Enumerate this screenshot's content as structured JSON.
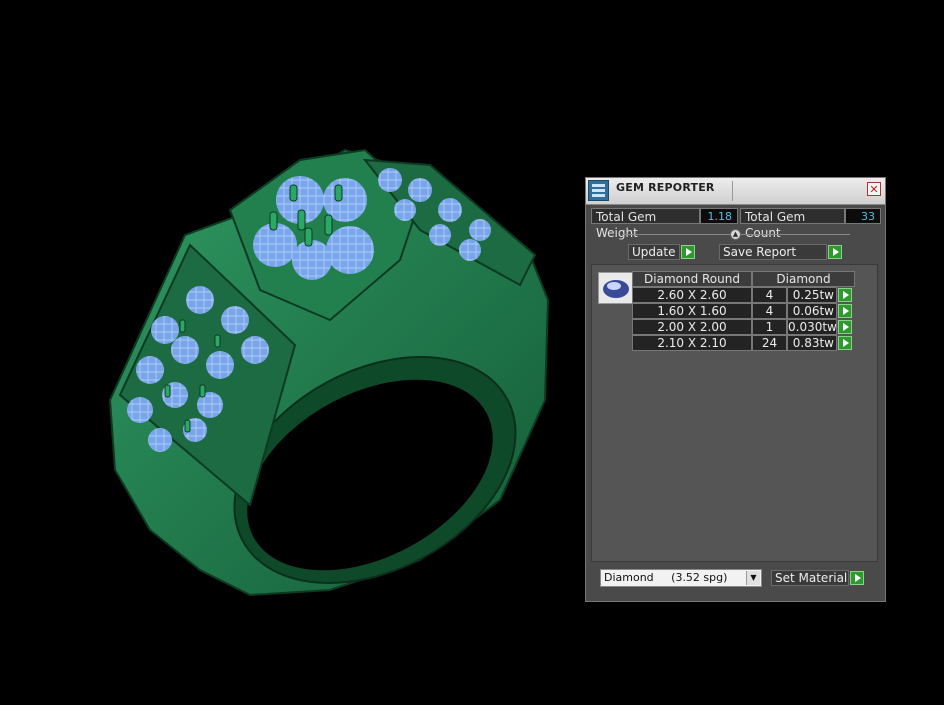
{
  "panel": {
    "title": "GEM REPORTER",
    "close_glyph": "✕",
    "total_weight_label": "Total Gem Weight",
    "total_weight_value": "1.18",
    "total_count_label": "Total Gem Count",
    "total_count_value": "33",
    "update_label": "Update",
    "save_report_label": "Save Report",
    "table": {
      "headers": [
        "Diamond Round",
        "Diamond"
      ],
      "rows": [
        {
          "size": "2.60 X 2.60",
          "count": "4",
          "weight": "0.25tw"
        },
        {
          "size": "1.60 X 1.60",
          "count": "4",
          "weight": "0.06tw"
        },
        {
          "size": "2.00 X 2.00",
          "count": "1",
          "weight": "0.030tw"
        },
        {
          "size": "2.10 X 2.10",
          "count": "24",
          "weight": "0.83tw"
        }
      ]
    },
    "material_select": "Diamond     (3.52 spg)",
    "set_material_label": "Set Material"
  },
  "icons": {
    "panel": "gem-reporter-icon",
    "gem": "diamond-gem-icon",
    "close": "close-icon",
    "arrow": "play-arrow-icon",
    "collapse": "collapse-knob-icon",
    "dropdown": "chevron-down-icon"
  },
  "colors": {
    "ring": "#1f7a4c",
    "gem": "#8fb2ff",
    "value_text": "#4ec3e0",
    "arrow_button": "#2e9a2e"
  }
}
